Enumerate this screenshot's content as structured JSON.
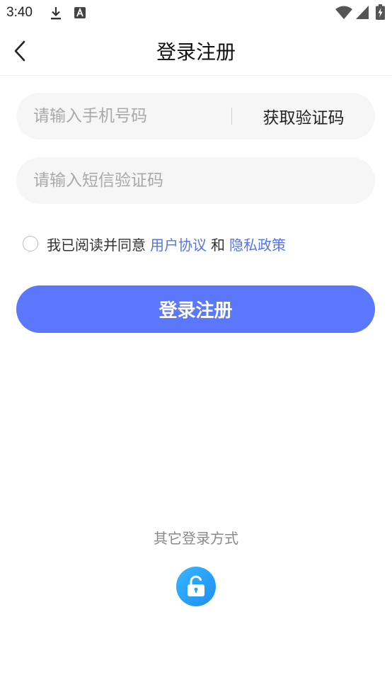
{
  "status_bar": {
    "time": "3:40",
    "icons": [
      "download-icon",
      "a-badge-icon",
      "wifi-icon",
      "signal-icon",
      "battery-icon"
    ]
  },
  "header": {
    "title": "登录注册",
    "back_icon": "chevron-left-icon"
  },
  "form": {
    "phone_placeholder": "请输入手机号码",
    "phone_value": "",
    "get_code_label": "获取验证码",
    "code_placeholder": "请输入短信验证码",
    "code_value": ""
  },
  "agreement": {
    "checked": false,
    "prefix": "我已阅读并同意",
    "user_agreement": "用户协议",
    "and": "和",
    "privacy_policy": "隐私政策"
  },
  "login_button_label": "登录注册",
  "other_login": {
    "label": "其它登录方式",
    "icon": "unlock-icon"
  },
  "colors": {
    "accent": "#5b77fb",
    "link": "#5573f0",
    "input_bg": "#f6f6f6",
    "unlock_icon_bg": "#2a9ff5"
  }
}
